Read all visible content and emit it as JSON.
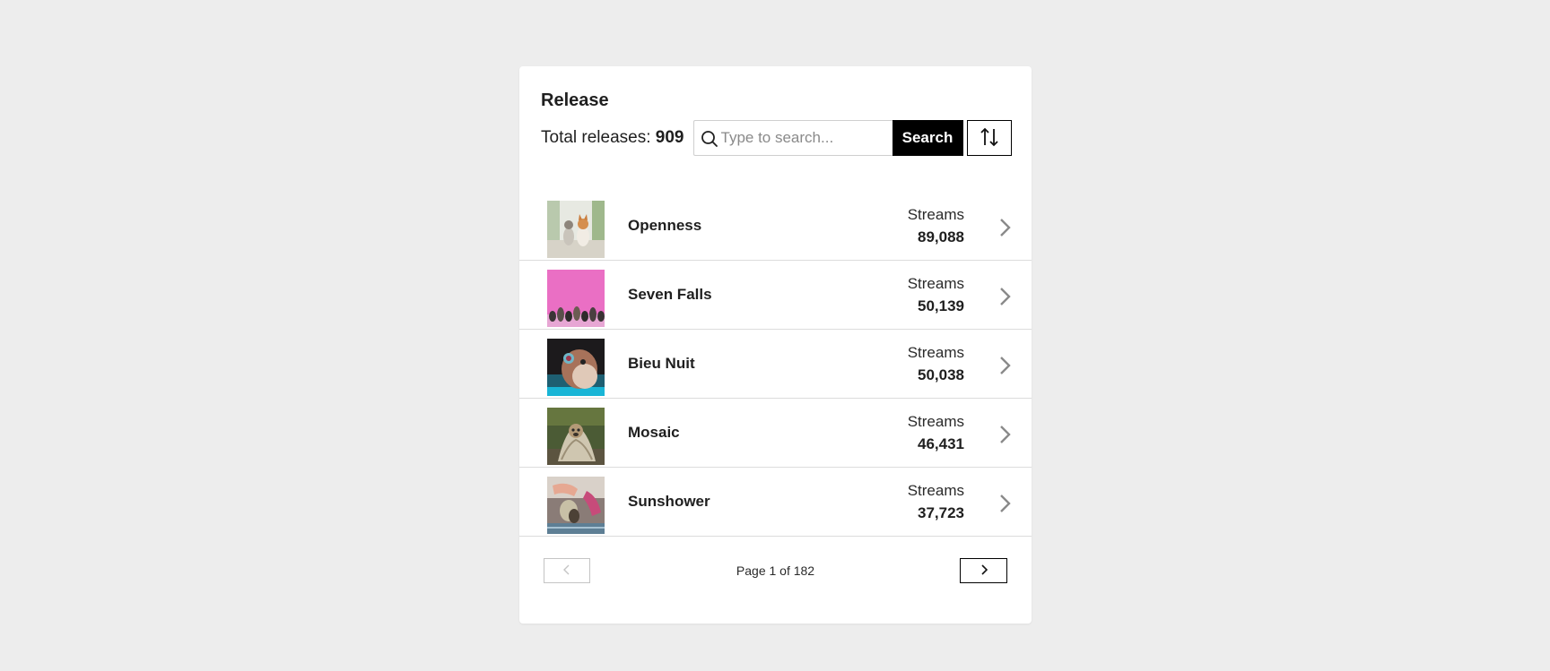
{
  "card": {
    "title": "Release",
    "total_label": "Total releases:",
    "total_count": "909"
  },
  "search": {
    "placeholder": "Type to search...",
    "value": "",
    "button_label": "Search",
    "sort_icon": "sort-arrows-icon"
  },
  "releases": [
    {
      "title": "Openness",
      "streams_label": "Streams",
      "streams": "89,088",
      "thumbnail": "dogs-on-path"
    },
    {
      "title": "Seven Falls",
      "streams_label": "Streams",
      "streams": "50,139",
      "thumbnail": "pets-pink-wall"
    },
    {
      "title": "Bieu Nuit",
      "streams_label": "Streams",
      "streams": "50,038",
      "thumbnail": "cat-closeup"
    },
    {
      "title": "Mosaic",
      "streams_label": "Streams",
      "streams": "46,431",
      "thumbnail": "pug-blanket"
    },
    {
      "title": "Sunshower",
      "streams_label": "Streams",
      "streams": "37,723",
      "thumbnail": "cat-paw-hand"
    }
  ],
  "pagination": {
    "text": "Page 1 of 182",
    "prev_icon": "chevron-left-icon",
    "next_icon": "chevron-right-icon",
    "prev_disabled": true
  },
  "colors": {
    "background": "#ededed",
    "card": "#ffffff",
    "primary_button": "#000000",
    "divider": "#dcdcdc",
    "chevron": "#8a8a8a"
  }
}
